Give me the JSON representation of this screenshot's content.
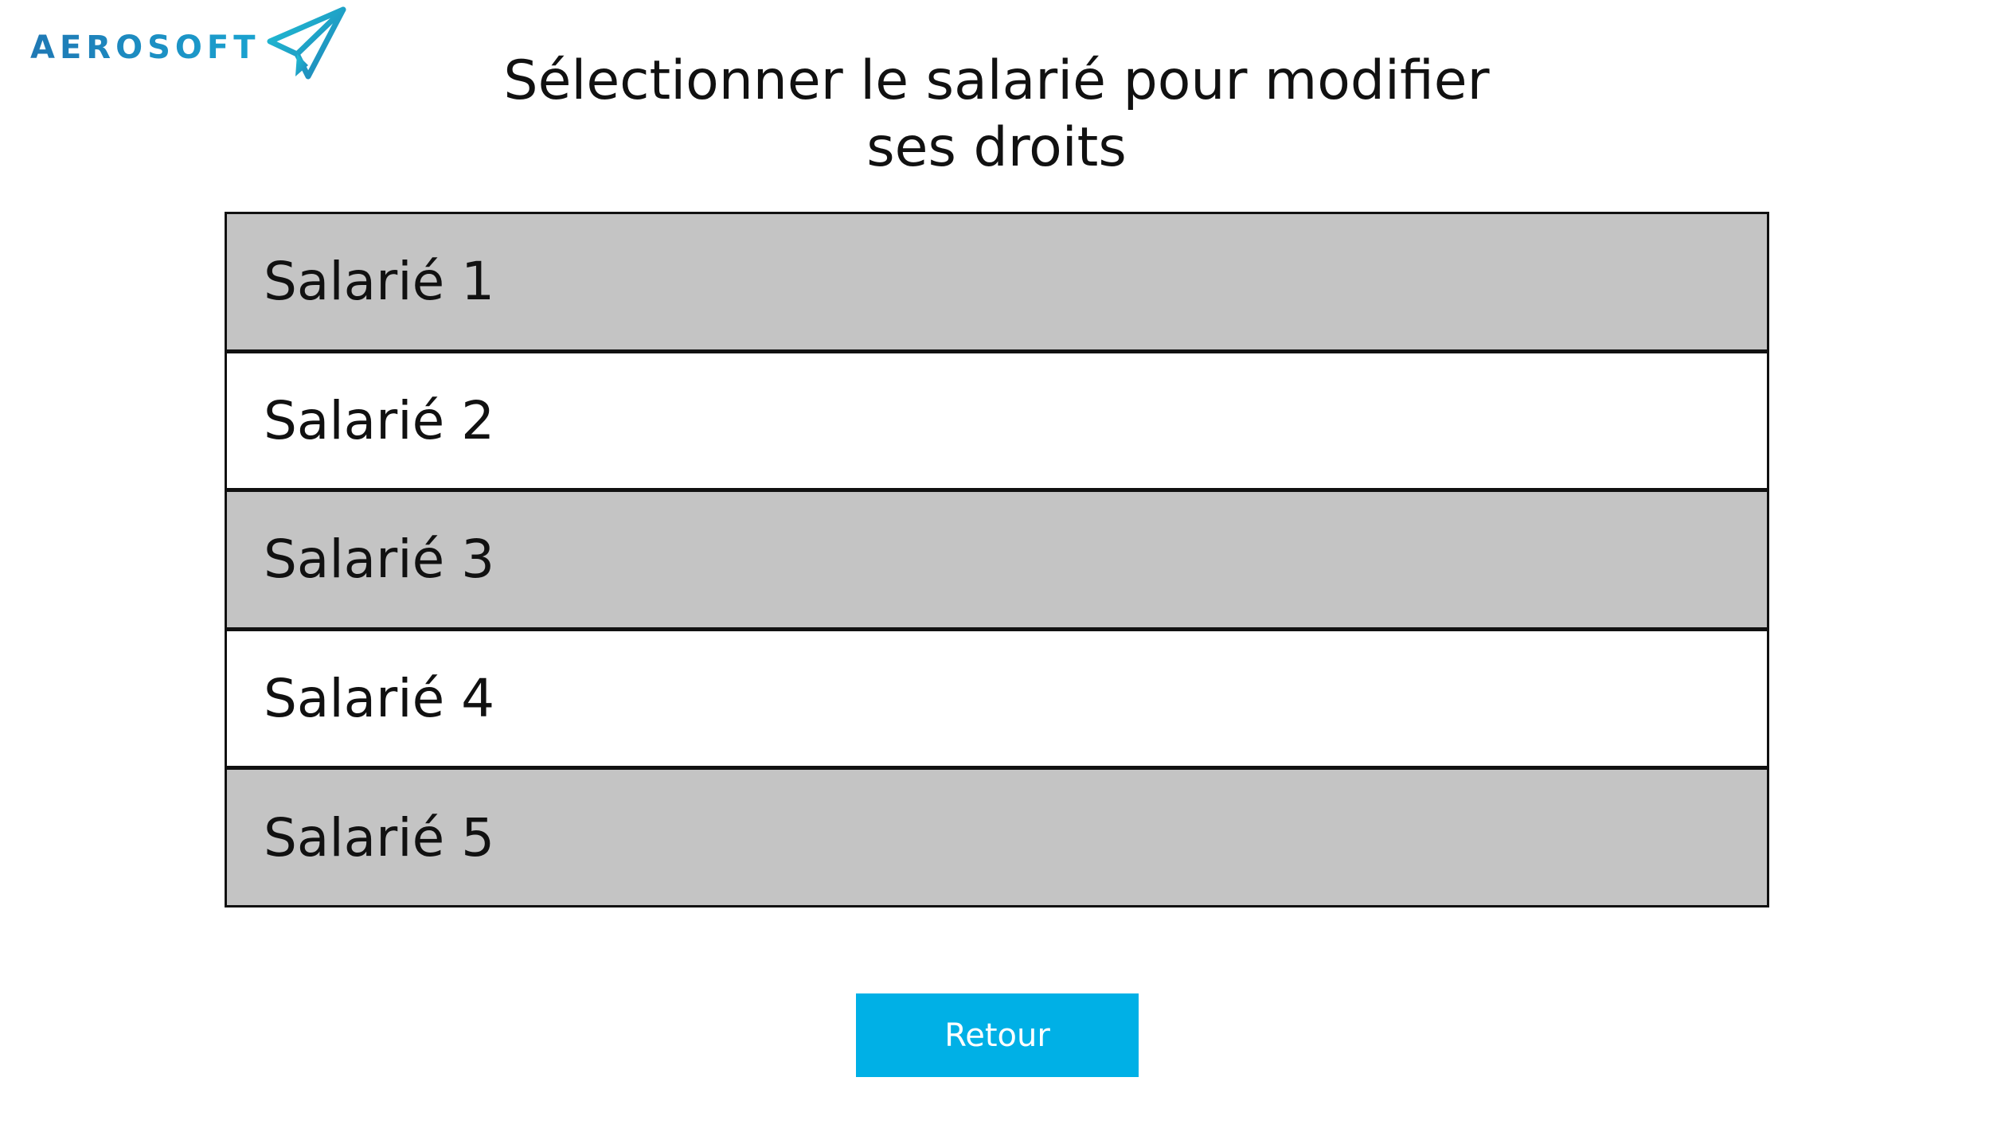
{
  "brand": {
    "name": "AEROSOFT",
    "logo_icon": "paper-plane-icon",
    "colors": {
      "primary": "#1f82b8",
      "accent": "#1fc2d6"
    }
  },
  "header": {
    "title_line1": "Sélectionner le salarié pour modifier",
    "title_line2": "ses droits"
  },
  "employees": [
    {
      "label": "Salarié 1"
    },
    {
      "label": "Salarié 2"
    },
    {
      "label": "Salarié 3"
    },
    {
      "label": "Salarié 4"
    },
    {
      "label": "Salarié 5"
    }
  ],
  "colors": {
    "row_shaded": "#c4c4c4",
    "row_plain": "#ffffff",
    "button": "#00b0e6"
  },
  "actions": {
    "back_label": "Retour"
  }
}
